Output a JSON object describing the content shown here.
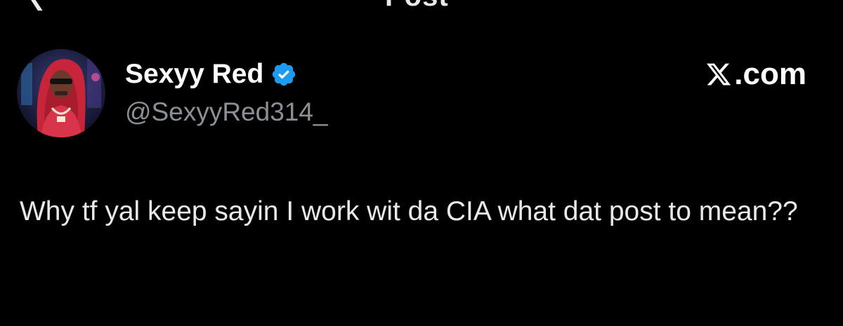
{
  "header": {
    "back_icon": "back-arrow-icon",
    "title": "Post"
  },
  "author": {
    "display_name": "Sexyy Red",
    "handle": "@SexyyRed314_",
    "verified": true,
    "verified_color": "#1d9bf0"
  },
  "site": {
    "logo_letter": "X",
    "logo_suffix": ".com"
  },
  "post": {
    "text": "Why tf yal keep sayin I work wit da CIA what dat post to mean??"
  },
  "colors": {
    "background": "#000000",
    "text_primary": "#e7e9ea",
    "text_secondary": "#8b9096",
    "accent": "#1d9bf0"
  }
}
